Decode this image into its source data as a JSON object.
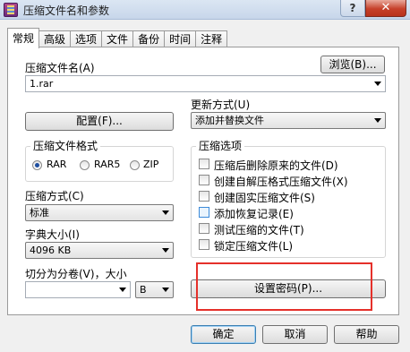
{
  "window": {
    "title": "压缩文件名和参数",
    "help_label": "?",
    "close_label": "✕"
  },
  "tabs": [
    {
      "label": "常规",
      "active": true
    },
    {
      "label": "高级"
    },
    {
      "label": "选项"
    },
    {
      "label": "文件"
    },
    {
      "label": "备份"
    },
    {
      "label": "时间"
    },
    {
      "label": "注释"
    }
  ],
  "general": {
    "archive_name_label": "压缩文件名(A)",
    "archive_name_value": "1.rar",
    "browse_label": "浏览(B)...",
    "update_mode_label": "更新方式(U)",
    "update_mode_value": "添加并替换文件",
    "profiles_label": "配置(F)...",
    "format": {
      "title": "压缩文件格式",
      "options": [
        {
          "label": "RAR",
          "checked": true
        },
        {
          "label": "RAR5",
          "checked": false
        },
        {
          "label": "ZIP",
          "checked": false
        }
      ]
    },
    "method_label": "压缩方式(C)",
    "method_value": "标准",
    "dict_label": "字典大小(I)",
    "dict_value": "4096 KB",
    "split_label": "切分为分卷(V)，大小",
    "split_value": "",
    "split_unit": "B",
    "options": {
      "title": "压缩选项",
      "items": [
        {
          "label": "压缩后删除原来的文件(D)",
          "checked": false
        },
        {
          "label": "创建自解压格式压缩文件(X)",
          "checked": false
        },
        {
          "label": "创建固实压缩文件(S)",
          "checked": false
        },
        {
          "label": "添加恢复记录(E)",
          "checked": false,
          "highlight": true
        },
        {
          "label": "测试压缩的文件(T)",
          "checked": false
        },
        {
          "label": "锁定压缩文件(L)",
          "checked": false
        }
      ]
    },
    "password_label": "设置密码(P)..."
  },
  "footer": {
    "ok_label": "确定",
    "cancel_label": "取消",
    "help_label": "帮助"
  },
  "colors": {
    "highlight_box": "#e5302a",
    "accent": "#1f4fa0"
  }
}
